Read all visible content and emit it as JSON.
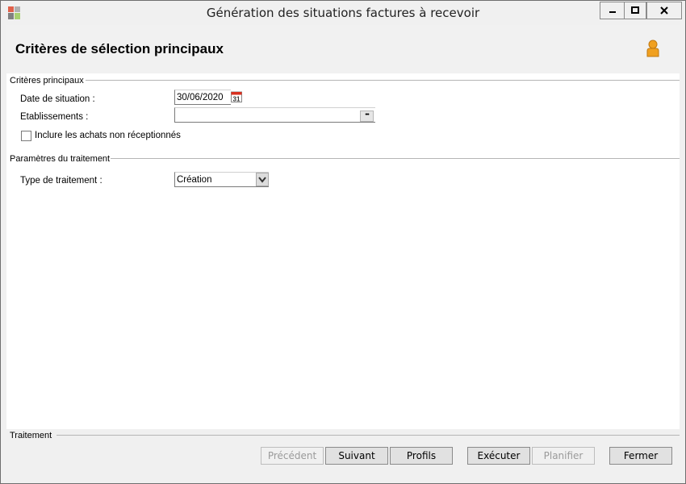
{
  "window": {
    "title": "Génération des situations factures à recevoir",
    "minimize_label": "▁",
    "maximize_label": "□",
    "close_label": "✕"
  },
  "header": {
    "title": "Critères de sélection principaux"
  },
  "criteria_section": {
    "label": "Critères principaux",
    "date_label": "Date de situation :",
    "date_value": "30/06/2020",
    "calendar_day": "31",
    "establishments_label": "Etablissements :",
    "establishments_value": "",
    "dots_label": "•••",
    "include_label": "Inclure les achats non réceptionnés",
    "include_checked": false
  },
  "processing_section": {
    "label": "Paramètres du traitement",
    "type_label": "Type de traitement :",
    "type_value": "Création"
  },
  "footer": {
    "label": "Traitement",
    "buttons": {
      "previous": "Précédent",
      "next": "Suivant",
      "profiles": "Profils",
      "execute": "Exécuter",
      "schedule": "Planifier",
      "close": "Fermer"
    }
  },
  "colors": {
    "accent_user_icon": "#f0a020",
    "calendar_red": "#d83020"
  }
}
